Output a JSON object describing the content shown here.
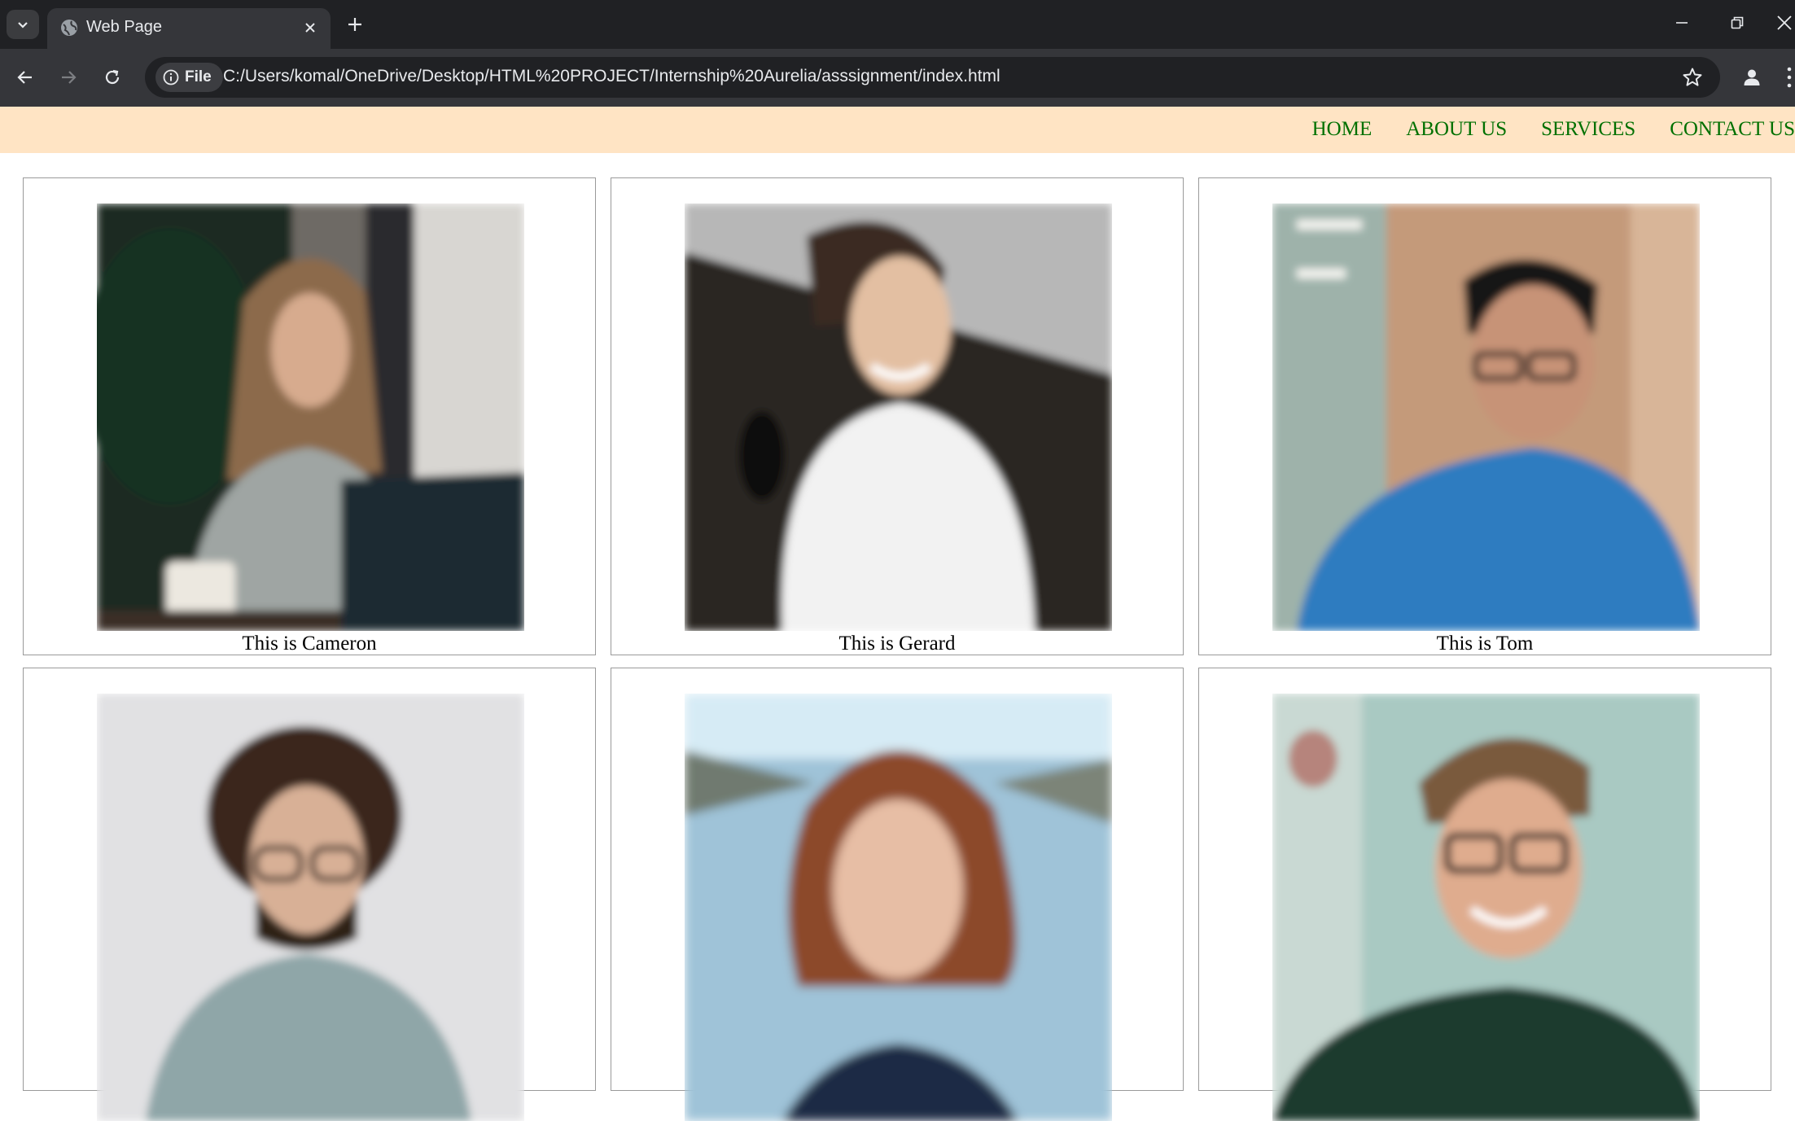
{
  "browser": {
    "tab_title": "Web Page",
    "address_chip": "File",
    "url": "C:/Users/komal/OneDrive/Desktop/HTML%20PROJECT/Internship%20Aurelia/asssignment/index.html"
  },
  "nav": {
    "links": [
      "HOME",
      "ABOUT US",
      "SERVICES",
      "CONTACT US"
    ]
  },
  "cards": [
    {
      "caption": "This is Cameron",
      "photo": "woman-with-laptop-photo"
    },
    {
      "caption": "This is Gerard",
      "photo": "smiling-young-man-photo"
    },
    {
      "caption": "This is Tom",
      "photo": "man-with-glasses-blue-sweater-photo"
    },
    {
      "caption": "",
      "photo": "curly-haired-man-photo"
    },
    {
      "caption": "",
      "photo": "red-haired-woman-photo"
    },
    {
      "caption": "",
      "photo": "smiling-man-with-glasses-photo"
    }
  ],
  "colors": {
    "nav_background": "#ffe4c4",
    "nav_link": "#007000",
    "browser_frame": "#202124",
    "browser_toolbar": "#35363a"
  },
  "icons": [
    "chevron-down-icon",
    "globe-icon",
    "close-icon",
    "plus-icon",
    "minimize-icon",
    "restore-icon",
    "back-arrow-icon",
    "forward-arrow-icon",
    "reload-icon",
    "info-icon",
    "star-icon",
    "profile-icon",
    "more-icon"
  ]
}
